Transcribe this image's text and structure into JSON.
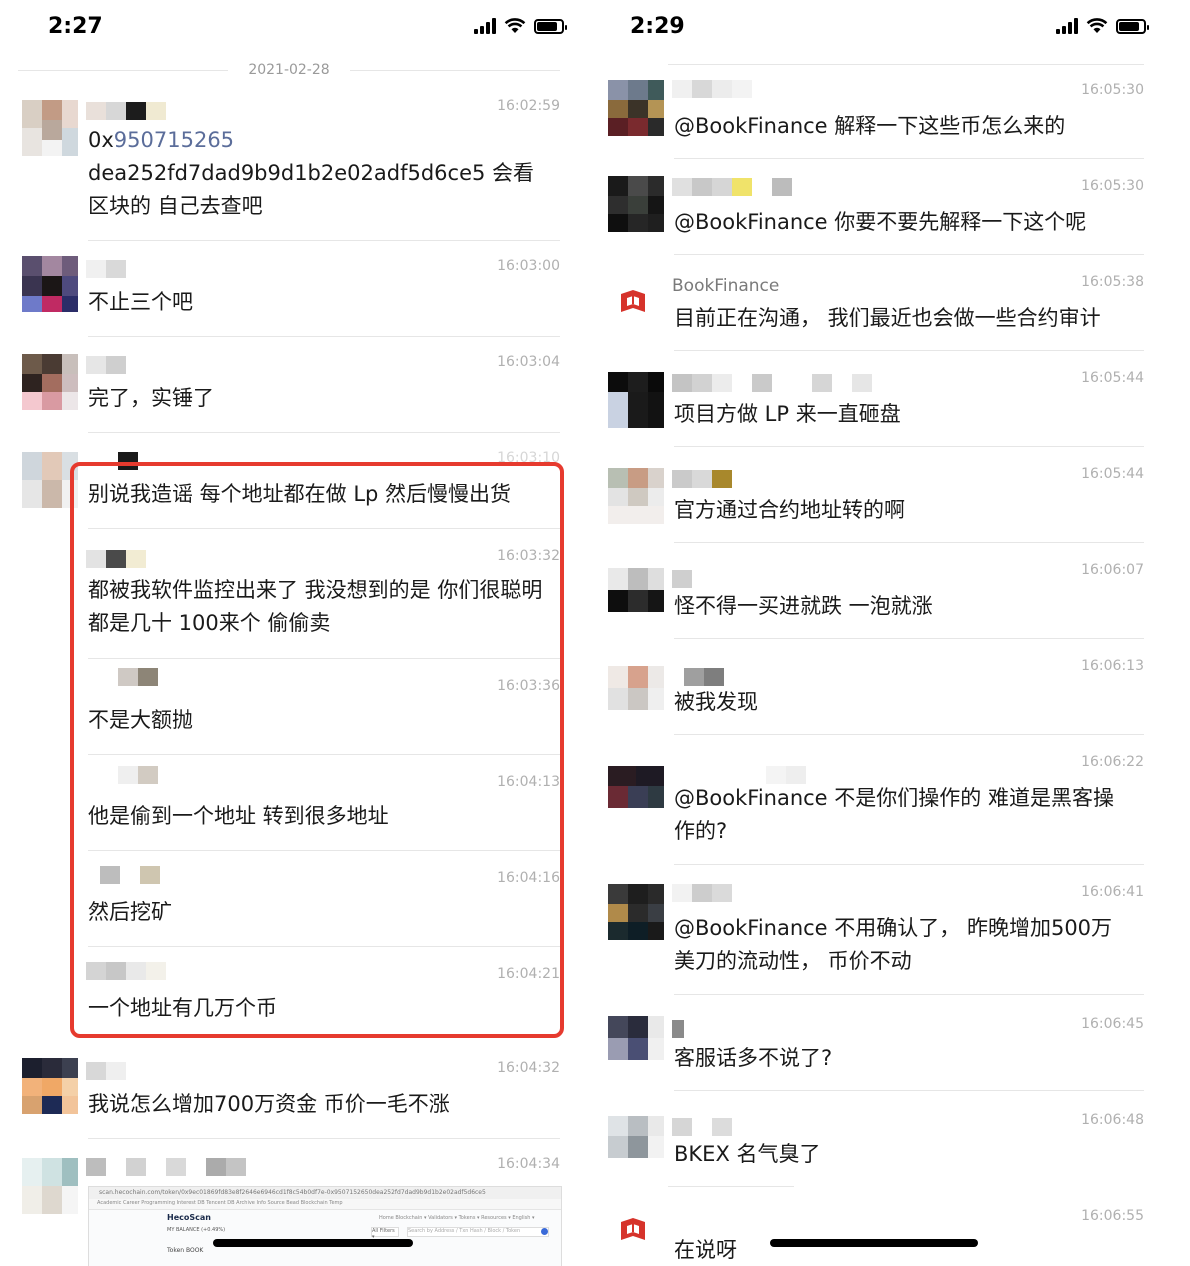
{
  "left": {
    "status_time": "2:27",
    "date": "2021-02-28",
    "messages": [
      {
        "time": "16:02:59",
        "text_prefix": "0x",
        "text_link": "950715265",
        "text_rest": "dea252fd7dad9b9d1b2e02adf5d6ce5  会看区块的 自己去查吧"
      },
      {
        "time": "16:03:00",
        "text": "不止三个吧"
      },
      {
        "time": "16:03:04",
        "text": "完了，实锤了"
      },
      {
        "time": "16:03:10",
        "text": "别说我造谣  每个地址都在做 Lp 然后慢慢出货"
      },
      {
        "time": "16:03:32",
        "text": "都被我软件监控出来了 我没想到的是  你们很聪明 都是几十 100来个 偷偷卖"
      },
      {
        "time": "16:03:36",
        "text": "不是大额抛"
      },
      {
        "time": "16:04:13",
        "text": "他是偷到一个地址 转到很多地址"
      },
      {
        "time": "16:04:16",
        "text": "然后挖矿"
      },
      {
        "time": "16:04:21",
        "text": "一个地址有几万个币"
      },
      {
        "time": "16:04:32",
        "text": "我说怎么增加700万资金  币价一毛不涨"
      },
      {
        "time": "16:04:34"
      }
    ],
    "screenshot": {
      "url": "scan.hecochain.com/token/0x9ec01869fd83e8f2646e6946cd1f8c54b0df7e-0x9507152650dea252fd7dad9b9d1b2e02adf5d6ce5",
      "bookmarks": "Academic   Career   Programming   Interest   DB Tencent   DB Archive   Info Source   Bead   Blockchain   Temp",
      "logo": "HecoScan",
      "nav": "Home    Blockchain ▾    Validators ▾    Tokens ▾    Resources ▾    English ▾",
      "address_label": "MY BALANCE (+0.49%)",
      "filter": "All Filters ▾",
      "search_placeholder": "Search by Address / Txn Hash / Block / Token",
      "token_label": "Token BOOK"
    }
  },
  "right": {
    "status_time": "2:29",
    "messages": [
      {
        "time": "16:05:30",
        "text": "@BookFinance 解释一下这些币怎么来的"
      },
      {
        "time": "16:05:30",
        "text": "@BookFinance 你要不要先解释一下这个呢"
      },
      {
        "time": "16:05:38",
        "name": "BookFinance",
        "text": "目前正在沟通，  我们最近也会做一些合约审计"
      },
      {
        "time": "16:05:44",
        "text": "项目方做 LP 来一直砸盘"
      },
      {
        "time": "16:05:44",
        "text": "官方通过合约地址转的啊"
      },
      {
        "time": "16:06:07",
        "text": "怪不得一买进就跌  一泡就涨"
      },
      {
        "time": "16:06:13",
        "text": "被我发现"
      },
      {
        "time": "16:06:22",
        "text": "@BookFinance 不是你们操作的 难道是黑客操作的?"
      },
      {
        "time": "16:06:41",
        "text": "@BookFinance 不用确认了，  昨晚增加500万美刀的流动性，  币价不动"
      },
      {
        "time": "16:06:45",
        "text": "客服话多不说了?"
      },
      {
        "time": "16:06:48",
        "text": "BKEX 名气臭了"
      },
      {
        "time": "16:06:55",
        "text": "在说呀"
      }
    ]
  },
  "colors": {
    "highlight_border": "#e63a2e",
    "link": "#5b6d9a",
    "book_red": "#d6332b",
    "timestamp": "#b0b0b0",
    "divider": "#e6e6e6"
  },
  "icons": [
    "signal-icon",
    "wifi-icon",
    "battery-icon",
    "bookfinance-logo-icon"
  ]
}
